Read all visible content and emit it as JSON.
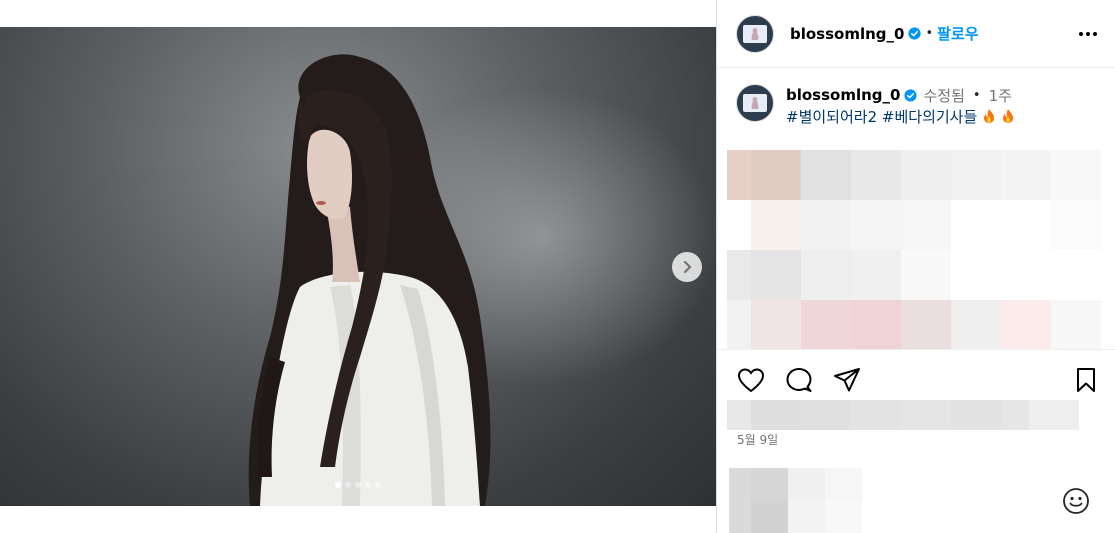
{
  "header": {
    "username": "blossomlng_0",
    "separator": "•",
    "follow_label": "팔로우",
    "avatar_icon": "profile-avatar",
    "more_icon": "more-horizontal-icon"
  },
  "caption": {
    "username": "blossomlng_0",
    "edited_label": "수정됨",
    "separator": "•",
    "time": "1주",
    "hashtag_1": "#별이되어라2",
    "hashtag_2": "#베다의기사들",
    "emoji": "fire-icon"
  },
  "carousel": {
    "image_count": 5,
    "current_index": 1,
    "next_icon": "chevron-right-icon"
  },
  "actions": {
    "like_icon": "heart-icon",
    "comment_icon": "comment-icon",
    "share_icon": "paper-plane-icon",
    "save_icon": "bookmark-icon"
  },
  "post_date": "5월 9일",
  "comment_box": {
    "emoji_icon": "smiley-icon"
  },
  "colors": {
    "follow": "#0095f6",
    "hashtag": "#00376b",
    "verified": "#0095f6",
    "muted_text": "#737373",
    "divider": "#dbdbdb"
  }
}
